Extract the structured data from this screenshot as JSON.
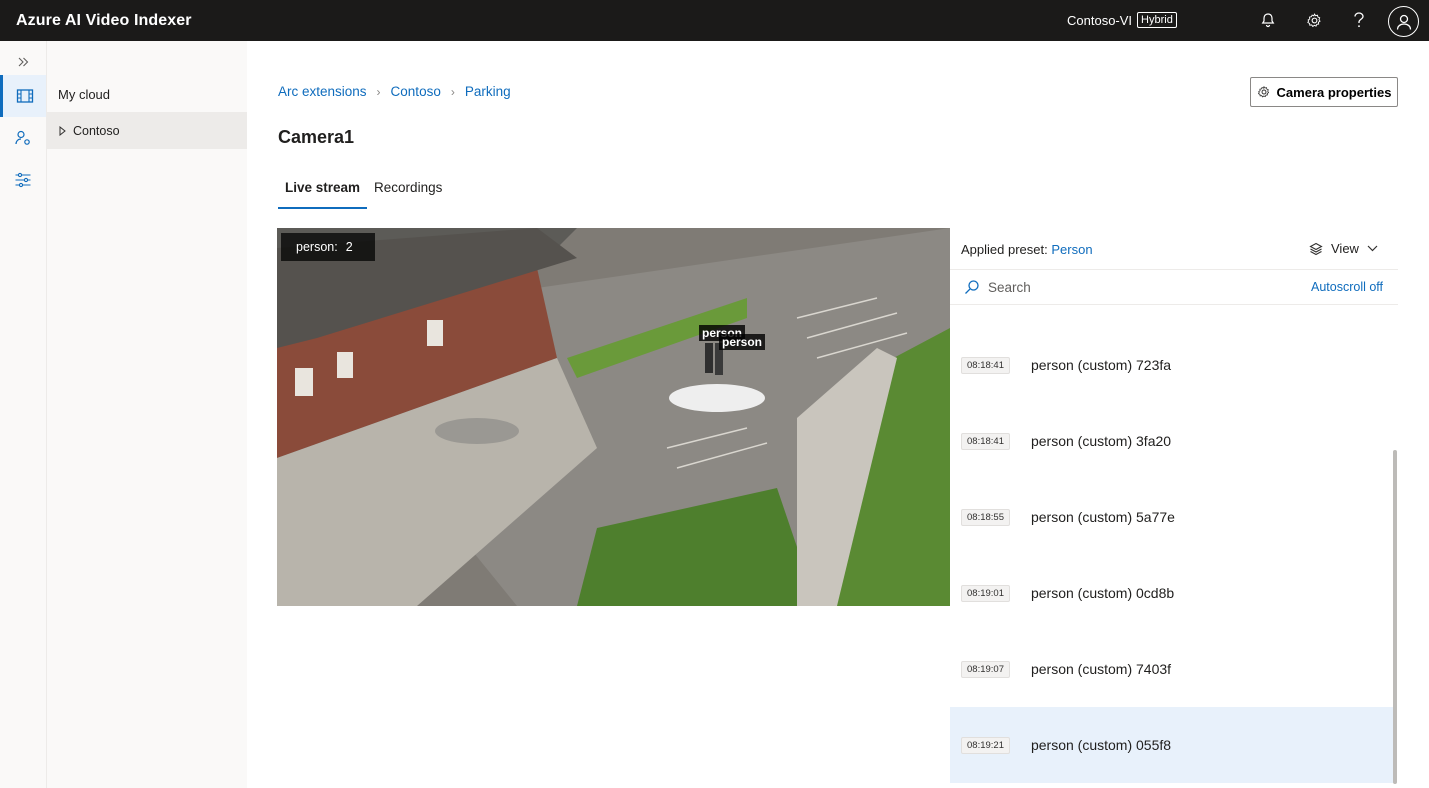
{
  "app": {
    "title": "Azure AI Video Indexer",
    "account_name": "Contoso-VI",
    "account_badge": "Hybrid"
  },
  "topbar_icons": [
    "bell-icon",
    "gear-icon",
    "help-icon",
    "user-icon"
  ],
  "rail": {
    "items": [
      "expand-icon",
      "video-library-icon",
      "people-settings-icon",
      "filters-icon"
    ],
    "active": "video-library-icon"
  },
  "tree": {
    "root": "My cloud",
    "item": "Contoso"
  },
  "breadcrumb": [
    "Arc extensions",
    "Contoso",
    "Parking"
  ],
  "camera_properties_label": "Camera properties",
  "page_title": "Camera1",
  "tabs": [
    {
      "label": "Live stream",
      "active": true
    },
    {
      "label": "Recordings",
      "active": false
    }
  ],
  "video": {
    "overlay_count_label": "person:",
    "overlay_count_value": "2",
    "detection_labels": [
      "person",
      "person"
    ]
  },
  "panel": {
    "applied_preset_label": "Applied preset:",
    "applied_preset_value": "Person",
    "view_label": "View",
    "search_placeholder": "Search",
    "autoscroll_label": "Autoscroll off",
    "events": [
      {
        "time": "08:18:41",
        "label": "person (custom) 723fa"
      },
      {
        "time": "08:18:41",
        "label": "person (custom) 3fa20"
      },
      {
        "time": "08:18:55",
        "label": "person (custom) 5a77e"
      },
      {
        "time": "08:19:01",
        "label": "person (custom) 0cd8b"
      },
      {
        "time": "08:19:07",
        "label": "person (custom) 7403f"
      },
      {
        "time": "08:19:21",
        "label": "person (custom) 055f8"
      }
    ],
    "selected_index": 5
  },
  "colors": {
    "topbar": "#1b1a19",
    "accent": "#0f6cbd",
    "selected_row": "#e8f1fb",
    "sidebar_bg": "#faf9f8"
  }
}
